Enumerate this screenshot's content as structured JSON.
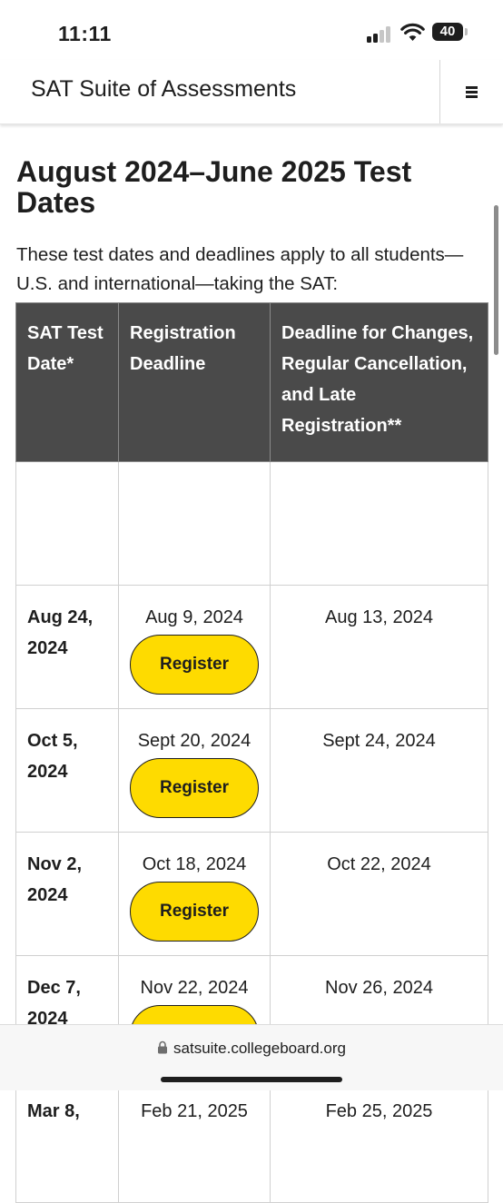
{
  "status_bar": {
    "time": "11:11",
    "battery": "40"
  },
  "header": {
    "title": "SAT Suite of Assessments",
    "menu_icon": "hamburger-icon"
  },
  "page": {
    "title": "August 2024–June 2025 Test Dates",
    "intro": "These test dates and deadlines apply to all students—U.S. and international—taking the SAT:"
  },
  "table": {
    "headers": [
      "SAT Test Date*",
      "Registration Deadline",
      "Deadline for Changes, Regular Cancellation, and Late Registration**"
    ],
    "rows": [
      {
        "test_date": "Aug 24, 2024",
        "registration_deadline": "Aug 9, 2024",
        "register_label": "Register",
        "late_deadline": "Aug 13, 2024"
      },
      {
        "test_date": "Oct 5, 2024",
        "registration_deadline": "Sept 20, 2024",
        "register_label": "Register",
        "late_deadline": "Sept 24, 2024"
      },
      {
        "test_date": "Nov 2, 2024",
        "registration_deadline": "Oct 18, 2024",
        "register_label": "Register",
        "late_deadline": "Oct 22, 2024"
      },
      {
        "test_date": "Dec 7, 2024",
        "registration_deadline": "Nov 22, 2024",
        "register_label": "Register",
        "late_deadline": "Nov 26, 2024"
      },
      {
        "test_date": "Mar 8,",
        "registration_deadline": "Feb 21, 2025",
        "register_label": "",
        "late_deadline": "Feb 25, 2025"
      }
    ]
  },
  "browser": {
    "url": "satsuite.collegeboard.org"
  },
  "colors": {
    "header_bg": "#4a4a4a",
    "button_yellow": "#fedb00",
    "text": "#1e1e1e"
  }
}
